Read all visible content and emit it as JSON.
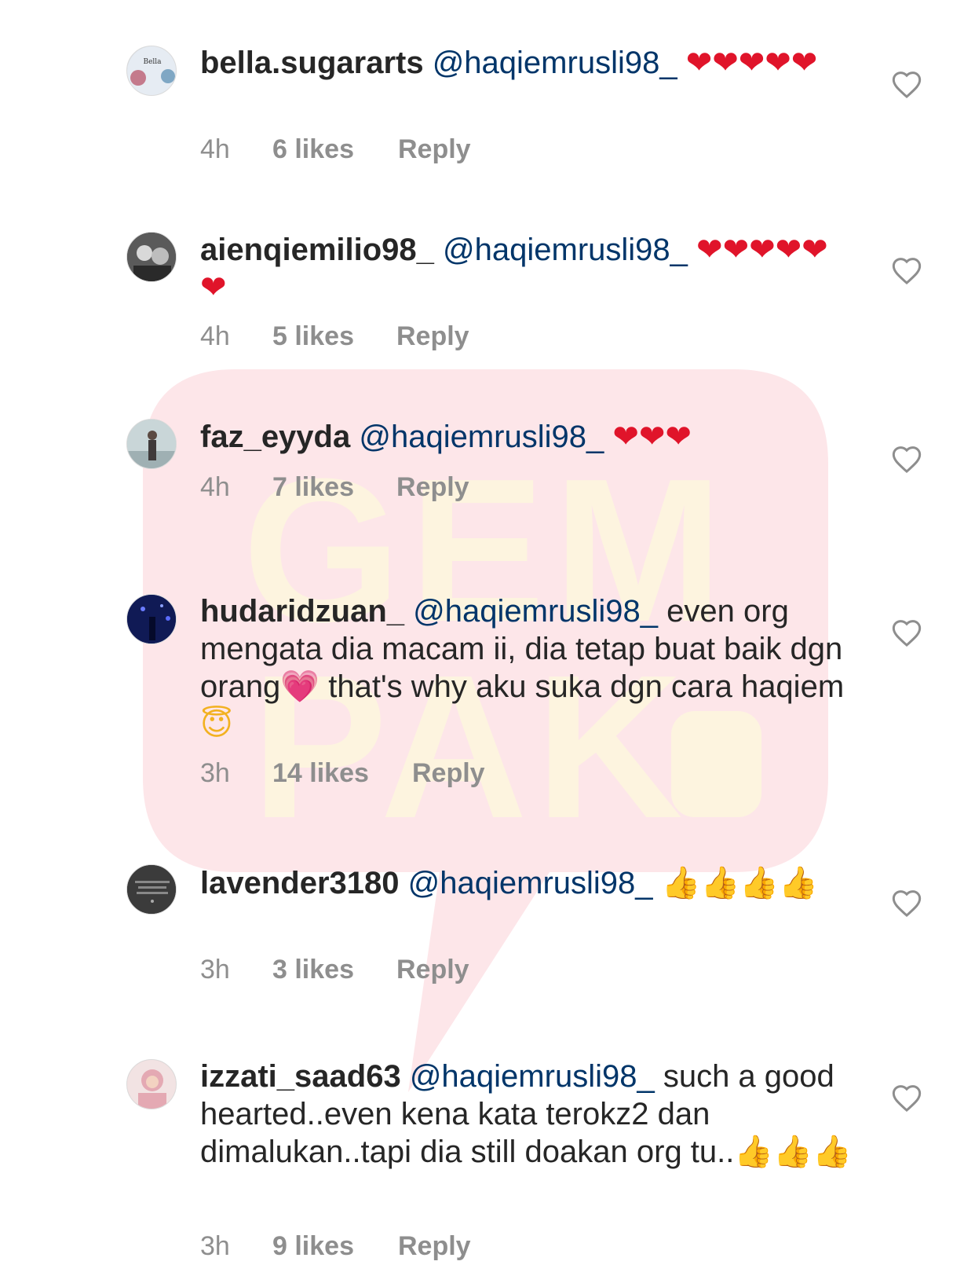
{
  "watermark": {
    "line1": "GEM",
    "line2": "PAK"
  },
  "comments": [
    {
      "username": "bella.sugararts",
      "mention": "@haqiemrusli98_",
      "text_before": "",
      "emoji": "❤❤❤❤❤",
      "text_after": "",
      "time": "4h",
      "likes": "6 likes",
      "reply": "Reply",
      "avatar_color": "#cfd8e3"
    },
    {
      "username": "aienqiemilio98_",
      "mention": "@haqiemrusli98_",
      "text_before": "",
      "emoji": "❤❤❤❤❤❤",
      "text_after": "",
      "time": "4h",
      "likes": "5 likes",
      "reply": "Reply",
      "avatar_color": "#3a3a3a"
    },
    {
      "username": "faz_eyyda",
      "mention": "@haqiemrusli98_",
      "text_before": "",
      "emoji": "❤❤❤",
      "text_after": "",
      "time": "4h",
      "likes": "7 likes",
      "reply": "Reply",
      "avatar_color": "#b7c7c9"
    },
    {
      "username": "hudaridzuan_",
      "mention": "@haqiemrusli98_",
      "text_before": "even org mengata dia macam ii, dia tetap buat baik dgn orang",
      "emoji": "💗",
      "text_after": " that's why aku suka dgn cara haqiem ",
      "emoji2": "😇",
      "time": "3h",
      "likes": "14 likes",
      "reply": "Reply",
      "avatar_color": "#1b2a6e"
    },
    {
      "username": "lavender3180",
      "mention": "@haqiemrusli98_",
      "text_before": "",
      "emoji": "👍👍👍👍",
      "text_after": "",
      "time": "3h",
      "likes": "3 likes",
      "reply": "Reply",
      "avatar_color": "#2d2d2d"
    },
    {
      "username": "izzati_saad63",
      "mention": "@haqiemrusli98_",
      "text_before": "such a good hearted..even kena kata terokz2 dan dimalukan..tapi dia still doakan org tu..",
      "emoji": "👍👍👍",
      "text_after": "",
      "time": "3h",
      "likes": "9 likes",
      "reply": "Reply",
      "avatar_color": "#e8c9c9"
    }
  ],
  "colors": {
    "text": "#262626",
    "mention": "#003569",
    "meta": "#8e8e8e",
    "heart": "#e0142a",
    "watermark_red": "#fce8ea",
    "watermark_yellow": "#fdf6e3"
  },
  "icons": {
    "like_button": "heart-outline-icon"
  }
}
